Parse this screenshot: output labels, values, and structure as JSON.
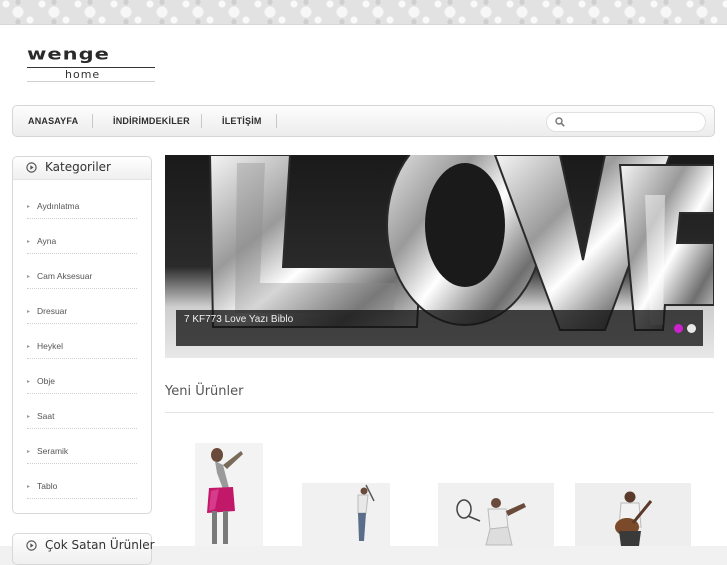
{
  "brand": {
    "logo_top": "wenge",
    "logo_bottom": "home"
  },
  "nav": {
    "items": [
      "ANASAYFA",
      "İNDİRİMDEKİLER",
      "İLETİŞİM"
    ],
    "search_placeholder": ""
  },
  "sidebar": {
    "title": "Kategoriler",
    "items": [
      "Aydınlatma",
      "Ayna",
      "Cam Aksesuar",
      "Dresuar",
      "Heykel",
      "Obje",
      "Saat",
      "Seramik",
      "Tablo"
    ]
  },
  "sidebar2": {
    "title": "Çok Satan Ürünler"
  },
  "slider": {
    "caption": "7 KF773 Love Yazı Biblo",
    "active_dot_color": "#cc22cc",
    "inactive_dot_color": "#e8e8e8"
  },
  "main": {
    "section_title": "Yeni Ürünler"
  },
  "products": [
    "dancing-figure",
    "golfer-figure",
    "tennis-player-figure",
    "guitarist-figure"
  ],
  "colors": {
    "accent": "#cc22cc",
    "nav_text": "#2e2e2e"
  }
}
